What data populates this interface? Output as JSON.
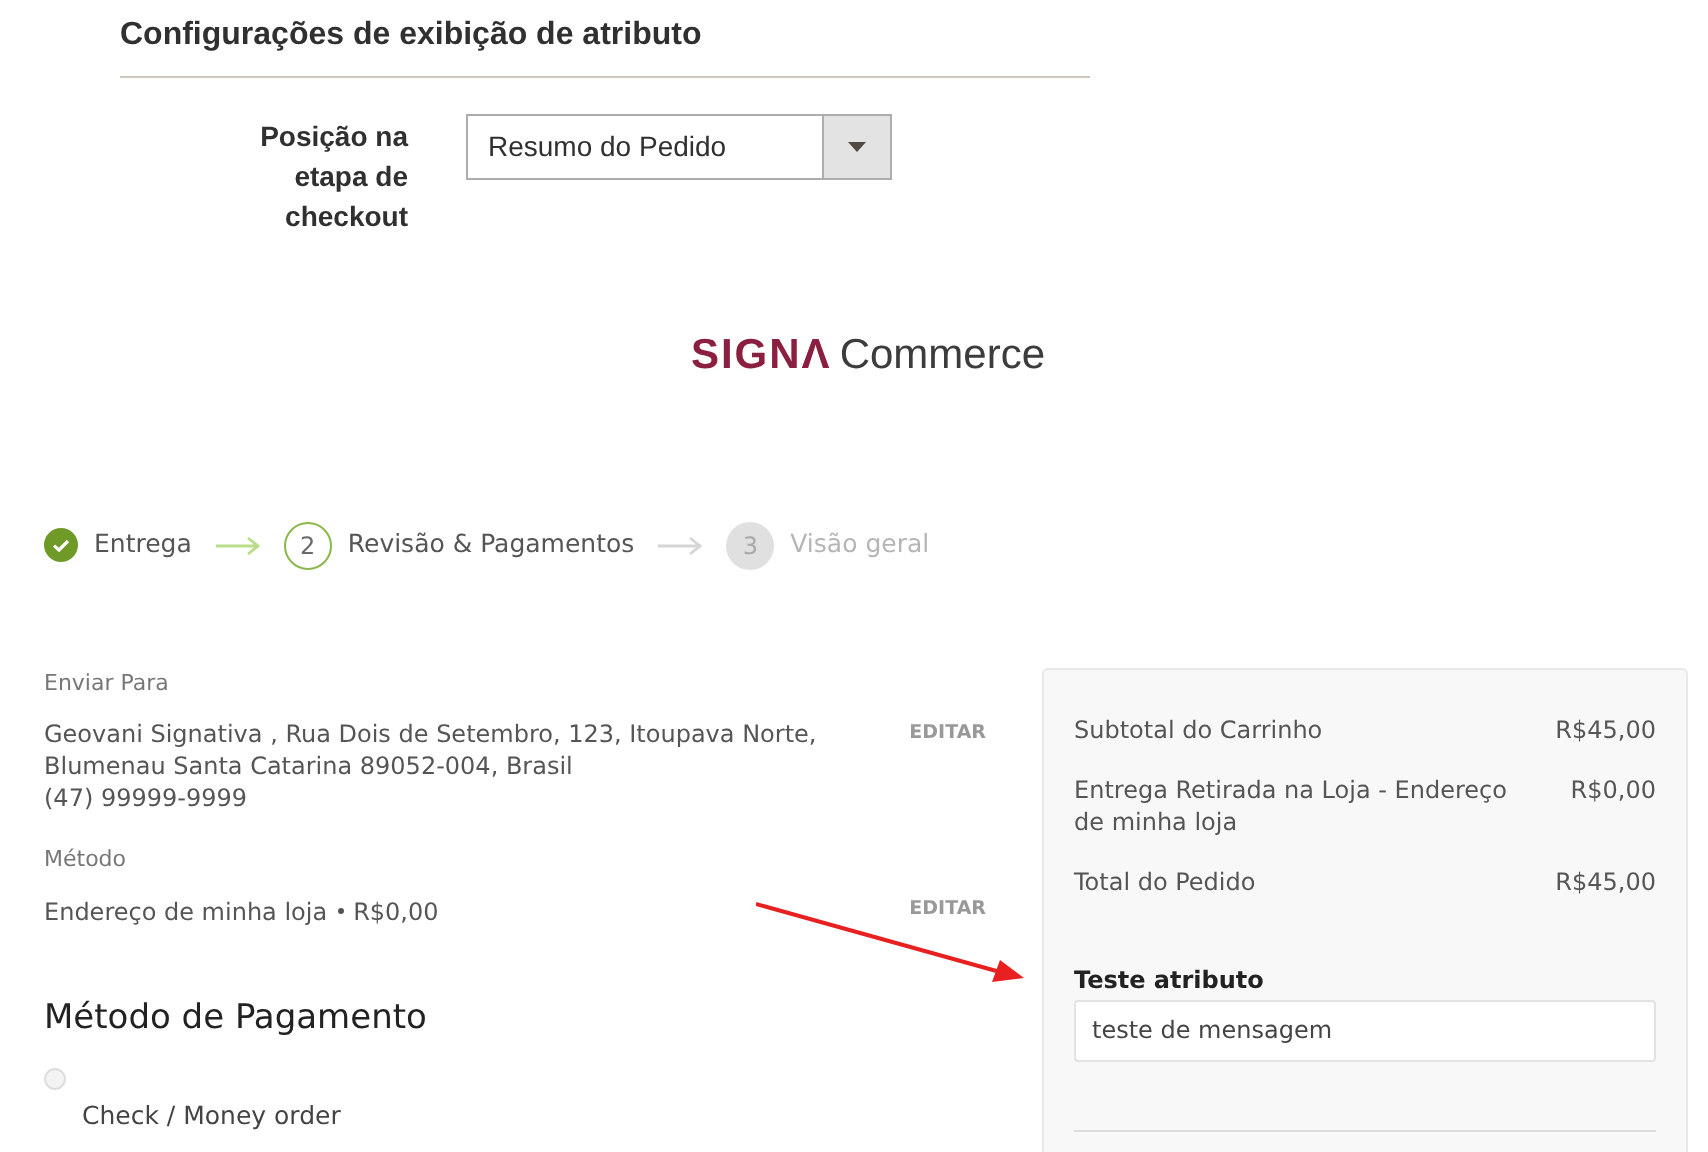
{
  "config": {
    "title": "Configurações de exibição de atributo",
    "field_label": "Posição na etapa de checkout",
    "select_value": "Resumo do Pedido"
  },
  "logo": {
    "brand": "SIGNΛ",
    "product": "Commerce"
  },
  "steps": [
    {
      "label": "Entrega",
      "kind": "done"
    },
    {
      "number": "2",
      "label": "Revisão & Pagamentos",
      "kind": "current"
    },
    {
      "number": "3",
      "label": "Visão geral",
      "kind": "upcoming"
    }
  ],
  "shipping": {
    "ship_to_label": "Enviar Para",
    "address_lines": [
      "Geovani Signativa , Rua Dois de Setembro, 123, Itoupava Norte,",
      "Blumenau Santa Catarina 89052-004, Brasil",
      "(47) 99999-9999"
    ],
    "edit_1": "EDITAR",
    "method_label": "Método",
    "method": "Endereço de minha loja",
    "method_price": "R$0,00",
    "edit_2": "EDITAR"
  },
  "payment": {
    "title": "Método de Pagamento",
    "options": [
      {
        "label": "Check / Money order",
        "selected": false
      }
    ]
  },
  "summary": {
    "rows": [
      {
        "label": "Subtotal do Carrinho",
        "value": "R$45,00"
      },
      {
        "label": "Entrega Retirada na Loja - Endereço de minha loja",
        "value": "R$0,00"
      },
      {
        "label": "Total do Pedido",
        "value": "R$45,00"
      }
    ],
    "attribute_label": "Teste atributo",
    "attribute_value": "teste de mensagem"
  }
}
